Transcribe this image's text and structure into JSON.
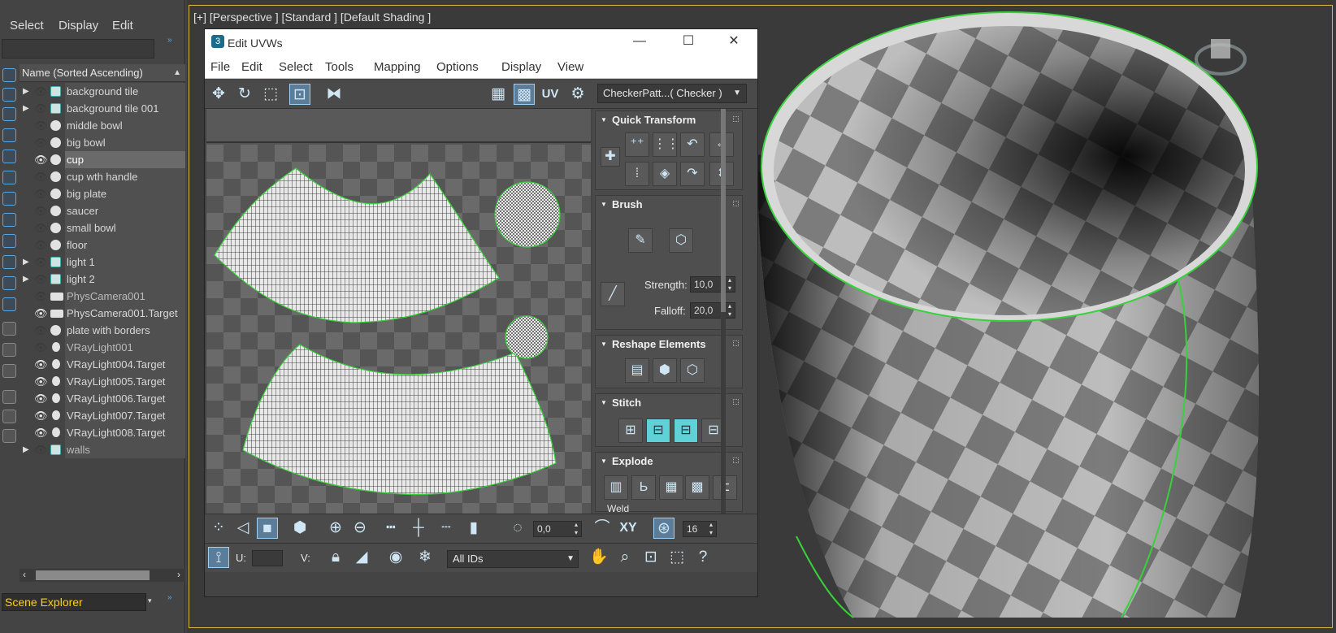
{
  "scene_explorer": {
    "menu": [
      "Select",
      "Display",
      "Edit"
    ],
    "column_header": "Name (Sorted Ascending)",
    "items": [
      {
        "label": "background tile",
        "icon": "image-icon",
        "expandable": true,
        "eye": false
      },
      {
        "label": "background tile 001",
        "icon": "image-icon",
        "expandable": true,
        "eye": false
      },
      {
        "label": "middle bowl",
        "icon": "sphere-icon",
        "expandable": false,
        "eye": false
      },
      {
        "label": "big bowl",
        "icon": "sphere-icon",
        "expandable": false,
        "eye": false
      },
      {
        "label": "cup",
        "icon": "sphere-icon",
        "expandable": false,
        "eye": true,
        "selected": true
      },
      {
        "label": "cup wth handle",
        "icon": "sphere-icon",
        "expandable": false,
        "eye": false
      },
      {
        "label": "big plate",
        "icon": "sphere-icon",
        "expandable": false,
        "eye": false
      },
      {
        "label": "saucer",
        "icon": "sphere-icon",
        "expandable": false,
        "eye": false
      },
      {
        "label": "small bowl",
        "icon": "sphere-icon",
        "expandable": false,
        "eye": false
      },
      {
        "label": "floor",
        "icon": "sphere-icon",
        "expandable": false,
        "eye": false
      },
      {
        "label": "light 1",
        "icon": "image-icon",
        "expandable": true,
        "eye": false
      },
      {
        "label": "light 2",
        "icon": "image-icon",
        "expandable": true,
        "eye": false
      },
      {
        "label": "PhysCamera001",
        "icon": "camera-icon",
        "expandable": false,
        "eye": false
      },
      {
        "label": "PhysCamera001.Target",
        "icon": "camera-icon",
        "expandable": false,
        "eye": true
      },
      {
        "label": "plate with borders",
        "icon": "sphere-icon",
        "expandable": false,
        "eye": false
      },
      {
        "label": "VRayLight001",
        "icon": "bulb-icon",
        "expandable": false,
        "eye": false
      },
      {
        "label": "VRayLight004.Target",
        "icon": "bulb-icon",
        "expandable": false,
        "eye": true
      },
      {
        "label": "VRayLight005.Target",
        "icon": "bulb-icon",
        "expandable": false,
        "eye": true
      },
      {
        "label": "VRayLight006.Target",
        "icon": "bulb-icon",
        "expandable": false,
        "eye": true
      },
      {
        "label": "VRayLight007.Target",
        "icon": "bulb-icon",
        "expandable": false,
        "eye": true
      },
      {
        "label": "VRayLight008.Target",
        "icon": "bulb-icon",
        "expandable": false,
        "eye": true
      },
      {
        "label": "walls",
        "icon": "image-icon",
        "expandable": true,
        "eye": false
      }
    ],
    "footer_label": "Scene Explorer"
  },
  "viewport": {
    "label": "[+] [Perspective ] [Standard ] [Default Shading ]"
  },
  "uvw_window": {
    "title": "Edit UVWs",
    "logo_glyph": "3",
    "window_buttons": {
      "minimize": "—",
      "maximize": "☐",
      "close": "✕"
    },
    "menu": [
      "File",
      "Edit",
      "Select",
      "Tools",
      "Mapping",
      "Options",
      "Display",
      "View"
    ],
    "toolbar_uv_label": "UV",
    "checker_select": "CheckerPatt...( Checker )",
    "rollouts": {
      "quick_transform": "Quick Transform",
      "brush": "Brush",
      "strength_label": "Strength:",
      "strength_value": "10,0",
      "falloff_label": "Falloff:",
      "falloff_value": "20,0",
      "reshape": "Reshape Elements",
      "stitch": "Stitch",
      "explode": "Explode",
      "weld": "Weld"
    },
    "bottom_toolbar": {
      "angle_value": "0,0",
      "xy_label": "XY",
      "count_value": "16",
      "u_label": "U:",
      "v_label": "V:",
      "ids_select": "All IDs"
    }
  },
  "colors": {
    "accent": "#5aa6e0",
    "teal": "#5fd2d8",
    "highlight": "#ffd400",
    "selection_outline": "#39d13b"
  }
}
